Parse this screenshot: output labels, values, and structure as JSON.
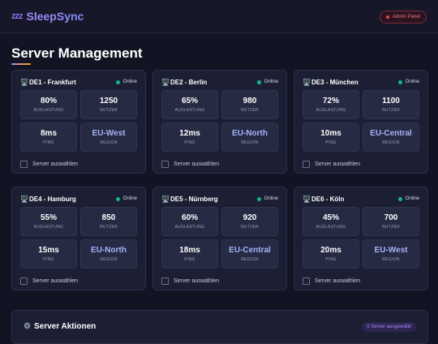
{
  "header": {
    "logo_icon": "zzz",
    "app_name": "SleepSync",
    "admin_label": "Admin Panel"
  },
  "page": {
    "title": "Server Management"
  },
  "labels": {
    "utilization": "AUSLASTUNG",
    "users": "NUTZER",
    "ping": "PING",
    "region": "REGION",
    "select": "Server auswählen"
  },
  "servers": [
    {
      "name": "DE1 - Frankfurt",
      "status": "Online",
      "utilization": "80%",
      "users": "1250",
      "ping": "8ms",
      "region": "EU-West"
    },
    {
      "name": "DE2 - Berlin",
      "status": "Online",
      "utilization": "65%",
      "users": "980",
      "ping": "12ms",
      "region": "EU-North"
    },
    {
      "name": "DE3 - München",
      "status": "Online",
      "utilization": "72%",
      "users": "1100",
      "ping": "10ms",
      "region": "EU-Central"
    },
    {
      "name": "DE4 - Hamburg",
      "status": "Online",
      "utilization": "55%",
      "users": "850",
      "ping": "15ms",
      "region": "EU-North"
    },
    {
      "name": "DE5 - Nürnberg",
      "status": "Online",
      "utilization": "60%",
      "users": "920",
      "ping": "18ms",
      "region": "EU-Central"
    },
    {
      "name": "DE6 - Köln",
      "status": "Online",
      "utilization": "45%",
      "users": "700",
      "ping": "20ms",
      "region": "EU-West"
    }
  ],
  "actions": {
    "title": "Server Aktionen",
    "selected_count": "0 Server ausgewählt"
  },
  "colors": {
    "accent": "#a78bfa",
    "online": "#10b981",
    "admin": "#f0727f"
  }
}
